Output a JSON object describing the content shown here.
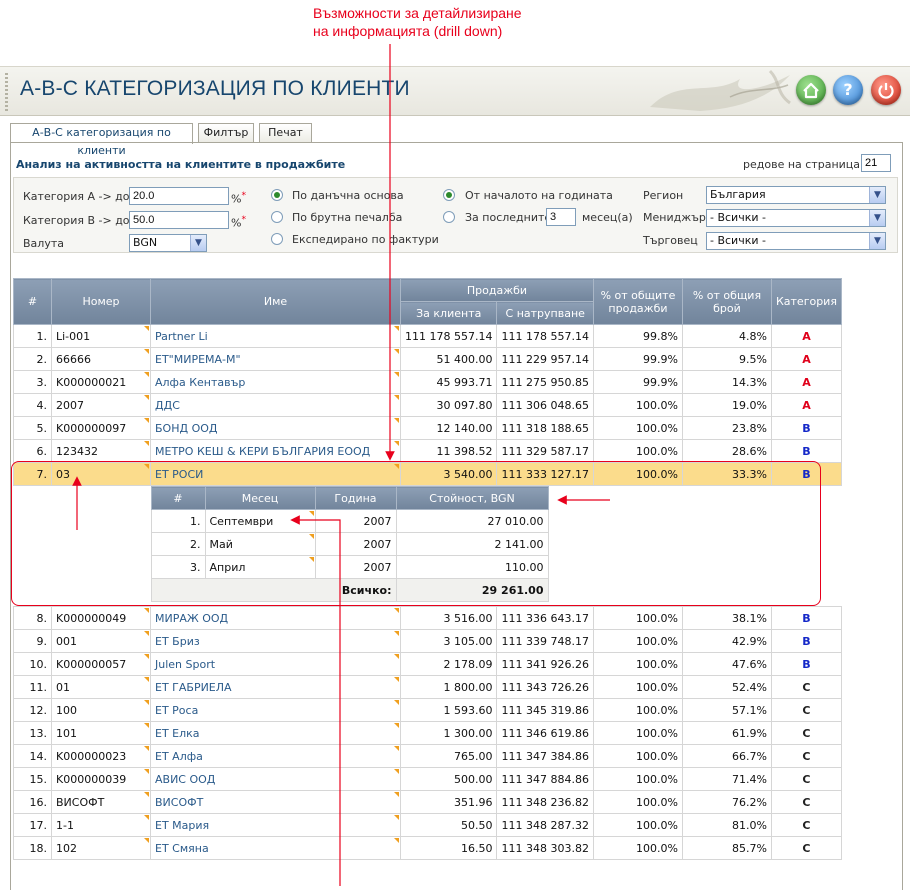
{
  "annotation": {
    "line1": "Възможности за детайлизиране",
    "line2": "на информацията (drill down)"
  },
  "window": {
    "title": "А-В-С КАТЕГОРИЗАЦИЯ ПО КЛИЕНТИ",
    "buttons": {
      "home": "home-icon",
      "help": "?",
      "power": "power-icon"
    }
  },
  "tabs": [
    {
      "label": "А-В-С категоризация по клиенти",
      "active": true
    },
    {
      "label": "Филтър",
      "active": false
    },
    {
      "label": "Печат",
      "active": false
    }
  ],
  "panel": {
    "header": "Анализ на активността на клиентите в продажбите",
    "rows_per_page_label": "редове на страница",
    "rows_per_page_arrow": "»",
    "rows_per_page_value": "21"
  },
  "filters": {
    "cat_a_label": "Категория A -> до",
    "cat_a_value": "20.0",
    "cat_b_label": "Категория B -> до",
    "cat_b_value": "50.0",
    "pct": "%",
    "required": "*",
    "currency_label": "Валута",
    "currency_value": "BGN",
    "basis": [
      {
        "label": "По данъчна основа",
        "selected": true
      },
      {
        "label": "По брутна печалба",
        "selected": false
      },
      {
        "label": "Експедирано по фактури",
        "selected": false
      }
    ],
    "period": [
      {
        "label": "От началото на годината",
        "selected": true
      },
      {
        "label": "За последните",
        "selected": false
      }
    ],
    "months_value": "3",
    "months_unit": "месец(а)",
    "region_label": "Регион",
    "region_value": "България",
    "manager_label": "Мениджър",
    "manager_value": "- Всички -",
    "trader_label": "Търговец",
    "trader_value": "- Всички -"
  },
  "grid": {
    "headers": {
      "num": "#",
      "code": "Номер",
      "name": "Име",
      "sales": "Продажби",
      "for_client": "За клиента",
      "cumulative": "С натрупване",
      "pct_sales": "% от общите продажби",
      "pct_count": "% от общия брой",
      "category": "Категория"
    },
    "rows": [
      {
        "n": "1.",
        "code": "Li-001",
        "name": "Partner Li",
        "v1": "111 178 557.14",
        "v2": "111 178 557.14",
        "p1": "99.8%",
        "p2": "4.8%",
        "cat": "A"
      },
      {
        "n": "2.",
        "code": "66666",
        "name": "ЕТ\"МИРЕМА-М\"",
        "v1": "51 400.00",
        "v2": "111 229 957.14",
        "p1": "99.9%",
        "p2": "9.5%",
        "cat": "A"
      },
      {
        "n": "3.",
        "code": "K000000021",
        "name": "Алфа Кентавър",
        "v1": "45 993.71",
        "v2": "111 275 950.85",
        "p1": "99.9%",
        "p2": "14.3%",
        "cat": "A"
      },
      {
        "n": "4.",
        "code": "2007",
        "name": "ДДС",
        "v1": "30 097.80",
        "v2": "111 306 048.65",
        "p1": "100.0%",
        "p2": "19.0%",
        "cat": "A"
      },
      {
        "n": "5.",
        "code": "K000000097",
        "name": "БОНД ООД",
        "v1": "12 140.00",
        "v2": "111 318 188.65",
        "p1": "100.0%",
        "p2": "23.8%",
        "cat": "B"
      },
      {
        "n": "6.",
        "code": "123432",
        "name": "МЕТРО КЕШ & КЕРИ БЪЛГАРИЯ ЕООД",
        "v1": "11 398.52",
        "v2": "111 329 587.17",
        "p1": "100.0%",
        "p2": "28.6%",
        "cat": "B"
      },
      {
        "n": "7.",
        "code": "03",
        "name": "ЕТ РОСИ",
        "v1": "3 540.00",
        "v2": "111 333 127.17",
        "p1": "100.0%",
        "p2": "33.3%",
        "cat": "B"
      },
      {
        "n": "8.",
        "code": "K000000049",
        "name": "МИРАЖ ООД",
        "v1": "3 516.00",
        "v2": "111 336 643.17",
        "p1": "100.0%",
        "p2": "38.1%",
        "cat": "B"
      },
      {
        "n": "9.",
        "code": "001",
        "name": "ЕТ Бриз",
        "v1": "3 105.00",
        "v2": "111 339 748.17",
        "p1": "100.0%",
        "p2": "42.9%",
        "cat": "B"
      },
      {
        "n": "10.",
        "code": "K000000057",
        "name": "Julen Sport",
        "v1": "2 178.09",
        "v2": "111 341 926.26",
        "p1": "100.0%",
        "p2": "47.6%",
        "cat": "B"
      },
      {
        "n": "11.",
        "code": "01",
        "name": "ЕТ ГАБРИЕЛА",
        "v1": "1 800.00",
        "v2": "111 343 726.26",
        "p1": "100.0%",
        "p2": "52.4%",
        "cat": "C"
      },
      {
        "n": "12.",
        "code": "100",
        "name": "ЕТ Роса",
        "v1": "1 593.60",
        "v2": "111 345 319.86",
        "p1": "100.0%",
        "p2": "57.1%",
        "cat": "C"
      },
      {
        "n": "13.",
        "code": "101",
        "name": "ЕТ Елка",
        "v1": "1 300.00",
        "v2": "111 346 619.86",
        "p1": "100.0%",
        "p2": "61.9%",
        "cat": "C"
      },
      {
        "n": "14.",
        "code": "K000000023",
        "name": "ЕТ Алфа",
        "v1": "765.00",
        "v2": "111 347 384.86",
        "p1": "100.0%",
        "p2": "66.7%",
        "cat": "C"
      },
      {
        "n": "15.",
        "code": "K000000039",
        "name": "АВИС ООД",
        "v1": "500.00",
        "v2": "111 347 884.86",
        "p1": "100.0%",
        "p2": "71.4%",
        "cat": "C"
      },
      {
        "n": "16.",
        "code": "ВИСОФТ",
        "name": "ВИСОФТ",
        "v1": "351.96",
        "v2": "111 348 236.82",
        "p1": "100.0%",
        "p2": "76.2%",
        "cat": "C"
      },
      {
        "n": "17.",
        "code": "1-1",
        "name": "ЕТ Мария",
        "v1": "50.50",
        "v2": "111 348 287.32",
        "p1": "100.0%",
        "p2": "81.0%",
        "cat": "C"
      },
      {
        "n": "18.",
        "code": "102",
        "name": "ЕТ Смяна",
        "v1": "16.50",
        "v2": "111 348 303.82",
        "p1": "100.0%",
        "p2": "85.7%",
        "cat": "C"
      }
    ]
  },
  "detail": {
    "headers": {
      "num": "#",
      "month": "Месец",
      "year": "Година",
      "value": "Стойност, BGN"
    },
    "rows": [
      {
        "n": "1.",
        "month": "Септември",
        "year": "2007",
        "value": "27 010.00"
      },
      {
        "n": "2.",
        "month": "Май",
        "year": "2007",
        "value": "2 141.00"
      },
      {
        "n": "3.",
        "month": "Април",
        "year": "2007",
        "value": "110.00"
      }
    ],
    "total_label": "Всичко:",
    "total_value": "29 261.00"
  },
  "colors": {
    "accent_red": "#e8001c",
    "header_blue": "#17466e",
    "cat_a": "#e0001a",
    "cat_b": "#1428c8",
    "selected_row": "#fbdc8c"
  }
}
